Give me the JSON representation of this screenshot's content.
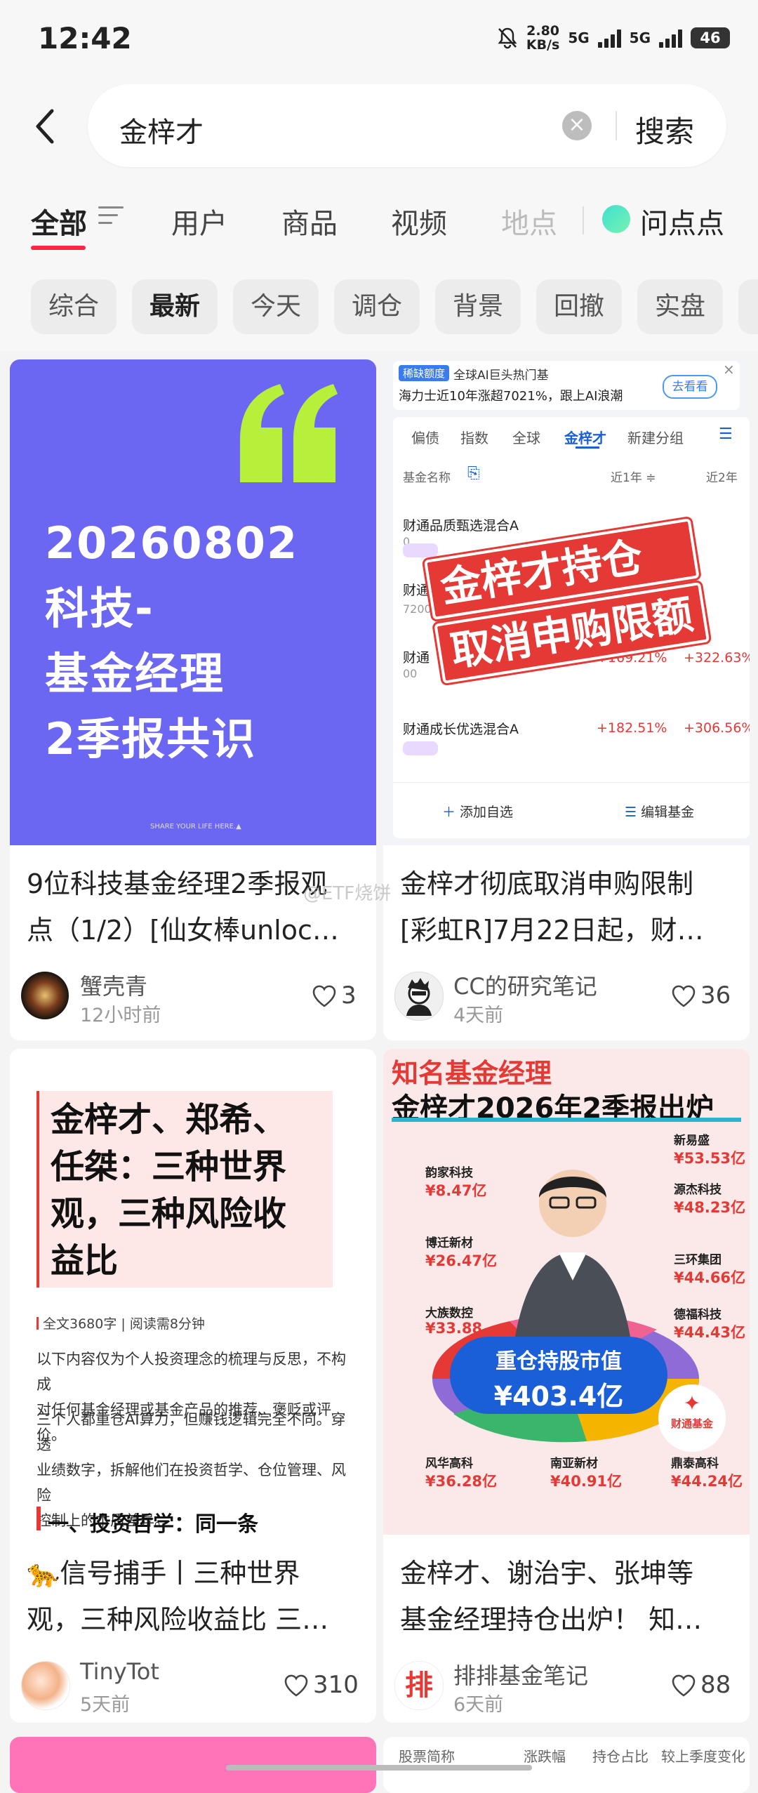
{
  "status_bar": {
    "time": "12:42",
    "speed_value": "2.80",
    "speed_unit": "KB/s",
    "signal1": "5G",
    "signal2": "5G",
    "battery": "46"
  },
  "search": {
    "query": "金梓才",
    "button": "搜索"
  },
  "tabs": [
    "全部",
    "用户",
    "商品",
    "视频",
    "地点",
    "问点点"
  ],
  "chips": [
    "综合",
    "最新",
    "今天",
    "调仓",
    "背景",
    "回撤",
    "实盘"
  ],
  "cards": [
    {
      "cover_lines": [
        "20260802",
        "科技-",
        "基金经理",
        "2季报共识"
      ],
      "cover_footer": "SHARE YOUR LIFE HERE.▲",
      "title_line1": "9位科技基金经理2季报观",
      "title_line2": "点（1/2）[仙女棒unloc…",
      "author": "蟹壳青",
      "time": "12小时前",
      "likes": "3"
    },
    {
      "ad_tag": "稀缺额度",
      "ad_line1": "全球AI巨头热门基",
      "ad_line2": "海力士近10年涨超7021%，跟上AI浪潮",
      "ad_button": "去看看",
      "fund_tabs": [
        "偏债",
        "指数",
        "全球",
        "金梓才",
        "新建分组"
      ],
      "col_name": "基金名称",
      "col_1y": "近1年 ≑",
      "col_2y": "近2年",
      "funds": [
        {
          "name": "财通品质甄选混合A",
          "code": "0",
          "y1": "--",
          "y2": "--"
        },
        {
          "name": "财通价",
          "code": "720001",
          "y1": "",
          "y2": ""
        },
        {
          "name": "财通",
          "code": "00",
          "y1": "+169.21%",
          "y2": "+322.63%"
        },
        {
          "name": "财通成长优选混合A",
          "code": "",
          "y1": "+182.51%",
          "y2": "+306.56%"
        }
      ],
      "add_fav": "添加自选",
      "edit_fund": "编辑基金",
      "stamp_line1": "金梓才持仓",
      "stamp_line2": "取消申购限额",
      "title_line1": "金梓才彻底取消申购限制",
      "title_line2": "[彩虹R]7月22日起，财…",
      "author": "CC的研究笔记",
      "time": "4天前",
      "likes": "36"
    },
    {
      "heading_lines": [
        "金梓才、郑希、",
        "任桀：三种世界",
        "观，三种风险收",
        "益比"
      ],
      "meta": "全文3680字 | 阅读需8分钟",
      "para1_line1": "以下内容仅为个人投资理念的梳理与反思，不构成",
      "para1_line2": "对任何基金经理或基金产品的推荐、褒贬或评价。",
      "para2_line1": "三个人都重仓AI算力，但赚钱逻辑完全不同。穿透",
      "para2_line2": "业绩数字，拆解他们在投资哲学、仓位管理、风险",
      "para2_line3": "控制上的本质差异。",
      "subheading": "一、投资哲学：同一条",
      "title_line1": "🐆信号捕手丨三种世界",
      "title_line2": "观，三种风险收益比 三…",
      "author": "TinyTot",
      "time": "5天前",
      "likes": "310"
    },
    {
      "head1": "知名基金经理",
      "head2": "金梓才2026年2季报出炉",
      "center_label": "重仓持股市值",
      "center_value": "¥403.4亿",
      "holdings": [
        {
          "name": "韵家科技",
          "value": "¥8.47亿"
        },
        {
          "name": "博迁新材",
          "value": "¥26.47亿"
        },
        {
          "name": "大族数控",
          "value": "¥33.88"
        },
        {
          "name": "风华高科",
          "value": "¥36.28亿"
        },
        {
          "name": "南亚新材",
          "value": "¥40.91亿"
        },
        {
          "name": "鼎泰高科",
          "value": "¥44.24亿"
        },
        {
          "name": "新易盛",
          "value": "¥53.53亿"
        },
        {
          "name": "源杰科技",
          "value": "¥48.23亿"
        },
        {
          "name": "三环集团",
          "value": "¥44.66亿"
        },
        {
          "name": "德福科技",
          "value": "¥44.43亿"
        }
      ],
      "logo_text": "财通基金",
      "title_line1": "金梓才、谢治宇、张坤等",
      "title_line2": "基金经理持仓出炉！ 知…",
      "author": "排排基金笔记",
      "time": "6天前",
      "likes": "88"
    }
  ],
  "watermark": "@ETF烧饼",
  "bottom_peek": {
    "col1": "股票简称",
    "col2": "涨跌幅",
    "col3": "持仓占比",
    "col4": "较上季度变化"
  },
  "colors": {
    "accent": "#ff2442",
    "cover_purple": "#6b67f2",
    "lime": "#b6f03a",
    "stamp_red": "#e53935"
  }
}
